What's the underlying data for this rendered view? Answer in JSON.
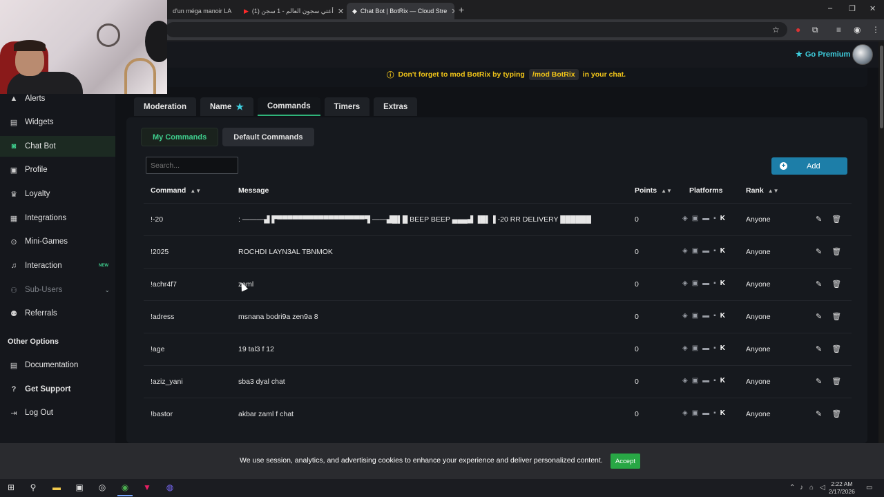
{
  "browser": {
    "tabs": [
      {
        "title": "d'un méga manoir LA"
      },
      {
        "title": "(1) أعتي سجون العالم - 1 سجن"
      },
      {
        "title": "Chat Bot | BotRix — Cloud Stre"
      }
    ],
    "new_tab": "+",
    "window_controls": [
      "–",
      "❐",
      "✕"
    ]
  },
  "header": {
    "premium_label": "Go Premium"
  },
  "banner": {
    "prefix": "Don't forget to mod BotRix by typing",
    "code": "/mod BotRix",
    "suffix": "in your chat."
  },
  "sidebar": {
    "items": [
      {
        "label": "Alerts",
        "icon": "warning-icon"
      },
      {
        "label": "Widgets",
        "icon": "widgets-icon"
      },
      {
        "label": "Chat Bot",
        "icon": "robot-icon"
      },
      {
        "label": "Profile",
        "icon": "profile-icon"
      },
      {
        "label": "Loyalty",
        "icon": "trophy-icon"
      },
      {
        "label": "Integrations",
        "icon": "integrations-icon"
      },
      {
        "label": "Mini-Games",
        "icon": "gamepad-icon"
      },
      {
        "label": "Interaction",
        "icon": "music-icon",
        "badge": "NEW"
      },
      {
        "label": "Sub-Users",
        "icon": "users-icon"
      },
      {
        "label": "Referrals",
        "icon": "referrals-icon"
      }
    ],
    "section_title": "Other Options",
    "other": [
      {
        "label": "Documentation",
        "icon": "book-icon"
      },
      {
        "label": "Get Support",
        "icon": "support-icon"
      },
      {
        "label": "Log Out",
        "icon": "logout-icon"
      }
    ]
  },
  "main_tabs": [
    "Moderation",
    "Name",
    "Commands",
    "Timers",
    "Extras"
  ],
  "sub_tabs": [
    "My Commands",
    "Default Commands"
  ],
  "search": {
    "placeholder": "Search..."
  },
  "add_button": "Add",
  "table": {
    "columns": [
      "Command",
      "Message",
      "Points",
      "Platforms",
      "Rank"
    ],
    "rows": [
      {
        "command": "!-20",
        "message": ": ———▟ ▛▀▀▀▀▀▀▀▀▀▀▀▀▀▀▀▀▀▜ ——▟█▌█ BEEP BEEP ▄▄▄▟ ▐█▌▐ -20 RR DELIVERY ██████",
        "points": "0",
        "rank": "Anyone"
      },
      {
        "command": "!2025",
        "message": "ROCHDI LAYN3AL TBNMOK",
        "points": "0",
        "rank": "Anyone"
      },
      {
        "command": "!achr4f7",
        "message": "zaml",
        "points": "0",
        "rank": "Anyone"
      },
      {
        "command": "!adress",
        "message": "msnana bodri9a zen9a 8",
        "points": "0",
        "rank": "Anyone"
      },
      {
        "command": "!age",
        "message": "19 tal3 f 12",
        "points": "0",
        "rank": "Anyone"
      },
      {
        "command": "!aziz_yani",
        "message": "sba3 dyal chat",
        "points": "0",
        "rank": "Anyone"
      },
      {
        "command": "!bastor",
        "message": "akbar zaml f chat",
        "points": "0",
        "rank": "Anyone"
      }
    ]
  },
  "cookie": {
    "text": "We use session, analytics, and advertising cookies to enhance your experience and deliver personalized content.",
    "accept": "Accept"
  },
  "taskbar": {
    "time": "2:22 AM",
    "date": "2/17/2026"
  },
  "colors": {
    "accent_green": "#3fcf8e",
    "premium": "#3fd0e0",
    "banner_yellow": "#f0c419",
    "add_button": "#1d7ea8",
    "accept": "#28a745"
  }
}
